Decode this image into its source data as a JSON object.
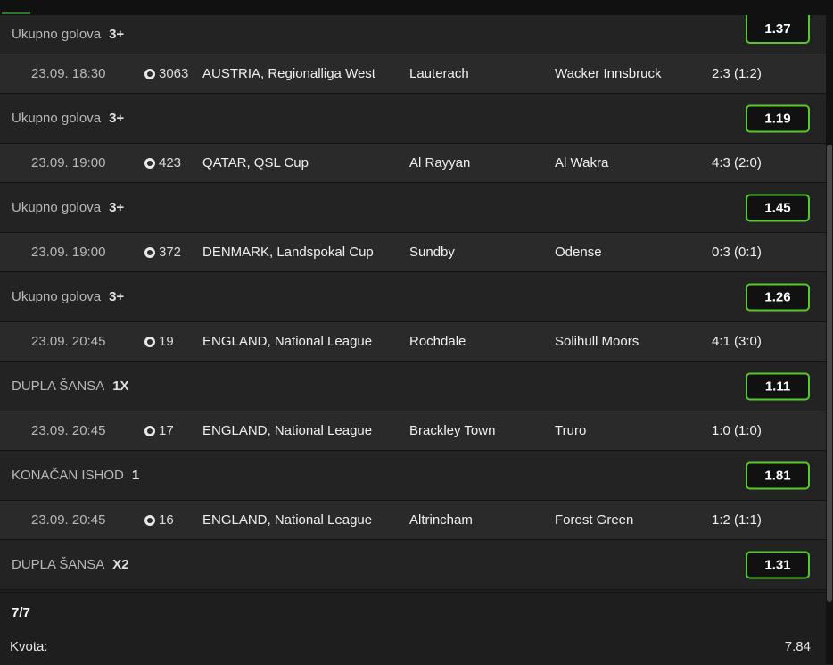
{
  "first_bet": {
    "type": "Ukupno golova",
    "pick": "3+",
    "odd": "1.37"
  },
  "matches": [
    {
      "date": "23.09. 18:30",
      "code": "3063",
      "league": "AUSTRIA, Regionalliga West",
      "home": "Lauterach",
      "away": "Wacker Innsbruck",
      "score": "2:3 (1:2)",
      "bet": {
        "type": "Ukupno golova",
        "pick": "3+",
        "odd": "1.19"
      }
    },
    {
      "date": "23.09. 19:00",
      "code": "423",
      "league": "QATAR, QSL Cup",
      "home": "Al Rayyan",
      "away": "Al Wakra",
      "score": "4:3 (2:0)",
      "bet": {
        "type": "Ukupno golova",
        "pick": "3+",
        "odd": "1.45"
      }
    },
    {
      "date": "23.09. 19:00",
      "code": "372",
      "league": "DENMARK, Landspokal Cup",
      "home": "Sundby",
      "away": "Odense",
      "score": "0:3 (0:1)",
      "bet": {
        "type": "Ukupno golova",
        "pick": "3+",
        "odd": "1.26"
      }
    },
    {
      "date": "23.09. 20:45",
      "code": "19",
      "league": "ENGLAND, National League",
      "home": "Rochdale",
      "away": "Solihull Moors",
      "score": "4:1 (3:0)",
      "bet": {
        "type": "DUPLA ŠANSA",
        "pick": "1X",
        "odd": "1.11"
      }
    },
    {
      "date": "23.09. 20:45",
      "code": "17",
      "league": "ENGLAND, National League",
      "home": "Brackley Town",
      "away": "Truro",
      "score": "1:0 (1:0)",
      "bet": {
        "type": "KONAČAN ISHOD",
        "pick": "1",
        "odd": "1.81"
      }
    },
    {
      "date": "23.09. 20:45",
      "code": "16",
      "league": "ENGLAND, National League",
      "home": "Altrincham",
      "away": "Forest Green",
      "score": "1:2 (1:1)",
      "bet": {
        "type": "DUPLA ŠANSA",
        "pick": "X2",
        "odd": "1.31"
      }
    }
  ],
  "summary": {
    "count": "7/7",
    "kvota_label": "Kvota:",
    "kvota_value": "7.84"
  },
  "icons": {
    "sport": "soccer-ball-icon"
  },
  "colors": {
    "accent": "#55c92a",
    "row_match": "#2a2a2a",
    "row_bet": "#232323"
  }
}
